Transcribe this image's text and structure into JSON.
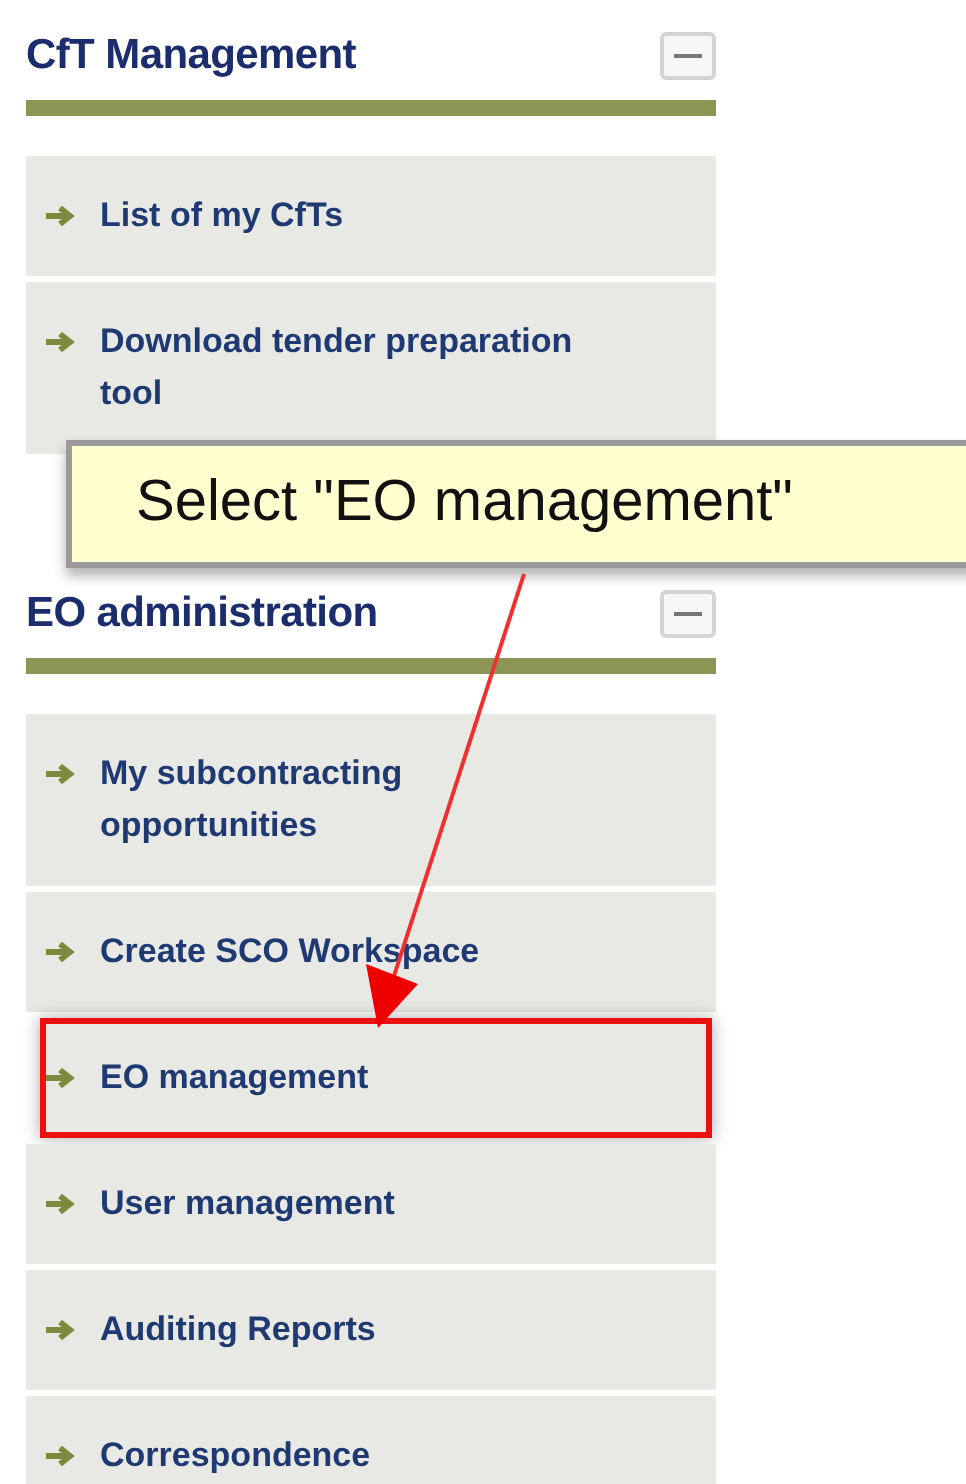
{
  "sections": [
    {
      "title": "CfT Management",
      "expanded": true,
      "items": [
        {
          "label": "List of my CfTs",
          "highlighted": false
        },
        {
          "label": "Download tender preparation tool",
          "highlighted": false
        }
      ]
    },
    {
      "title": "EO administration",
      "expanded": true,
      "items": [
        {
          "label": "My subcontracting opportunities",
          "highlighted": false
        },
        {
          "label": "Create SCO Workspace",
          "highlighted": false
        },
        {
          "label": "EO management",
          "highlighted": true
        },
        {
          "label": "User management",
          "highlighted": false
        },
        {
          "label": "Auditing Reports",
          "highlighted": false
        },
        {
          "label": "Correspondence",
          "highlighted": false
        }
      ]
    }
  ],
  "callout": {
    "text": "Select \"EO management\""
  }
}
